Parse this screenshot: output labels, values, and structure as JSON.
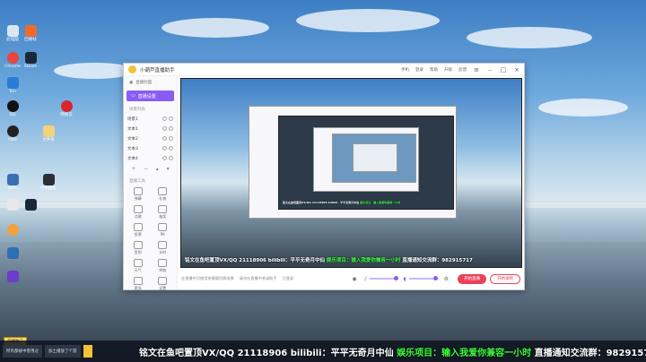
{
  "window": {
    "title": "小葫芦直播助手",
    "header_links": [
      "手机",
      "登录",
      "帮助",
      "升级",
      "反馈"
    ],
    "sidebar": {
      "top_label": "直播封面",
      "active_tab": "直播设置",
      "section_title": "场景列表",
      "sources": [
        "场景1",
        "文本1",
        "文本2",
        "文本3",
        "文本4"
      ],
      "tools_title": "直播工具",
      "tools": [
        "弹幕",
        "礼物",
        "点歌",
        "抽奖",
        "投票",
        "PK",
        "签到",
        "计时",
        "天气",
        "特效",
        "更多",
        "设置"
      ]
    },
    "bottom": {
      "info_left": "在直播中可使用快捷键切换场景",
      "info_mid": "请勿在直播中关闭助手",
      "info_right": "已登录",
      "start_button": "开始直播",
      "record_button": "开始录制"
    }
  },
  "marquee": {
    "white": "铭文在鱼吧置顶VX/QQ 21118906  bilibili：平平无奇月中仙",
    "green": "娱乐项目：输入我爱你兼容一小时",
    "yellow": "直播通知交流群：982915717"
  },
  "taskbar": {
    "notification": "开播啦了",
    "items": [
      "所有都被中客用过",
      "加土播放了个游"
    ]
  },
  "desktop_icons": [
    "此电脑",
    "回收站",
    "Chrome",
    "Steam",
    "Ten",
    "QQ",
    "网易云",
    "OBS",
    "文件夹",
    "WPS",
    "控制面板"
  ]
}
